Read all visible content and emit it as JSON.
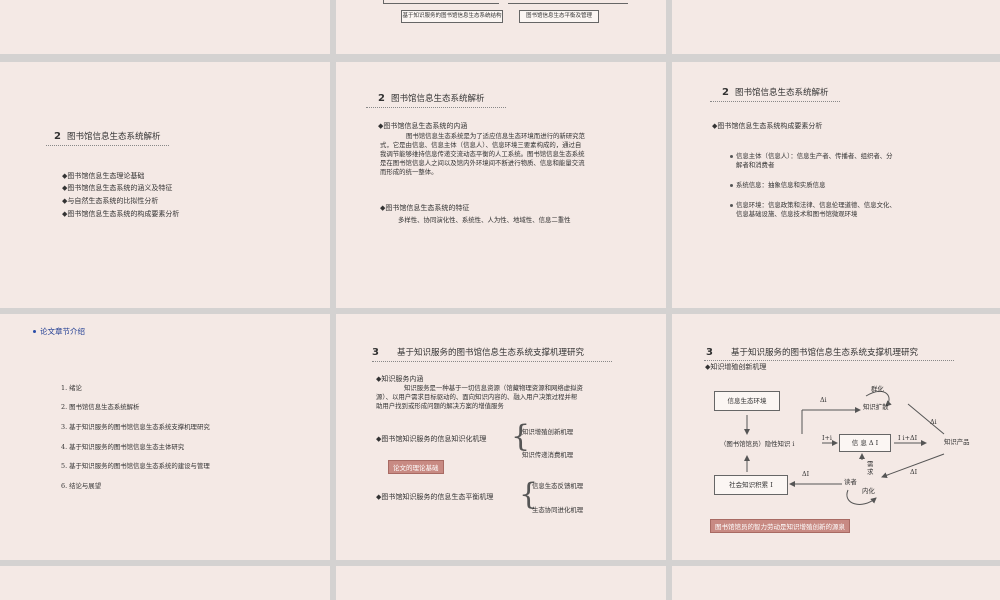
{
  "top_strip": {
    "box_left": "基于知识服务的图书馆信息生态系统结构",
    "box_right": "图书馆信息生态平衡及管理"
  },
  "slide_overview": {
    "number": "2",
    "title": "图书馆信息生态系统解析",
    "items": [
      "◆图书馆信息生态理论基础",
      "◆图书馆信息生态系统的涵义及特征",
      "◆与自然生态系统的比拟性分析",
      "◆图书馆信息生态系统的构成要素分析"
    ]
  },
  "slide_meaning": {
    "number": "2",
    "title": "图书馆信息生态系统解析",
    "heading1": "◆图书馆信息生态系统的内涵",
    "para1": [
      "图书馆信息生态系统是为了适应信息生态环境而进行的新研究范",
      "式，它是由信息、信息主体（信息人）、信息环境三要素构成的，通过自",
      "我调节能够维持信息传递交流动态平衡的人工系统。图书馆信息生态系统",
      "是在图书馆信息人之间以及馆内外环境间不断进行物质、信息和能量交流",
      "而形成的统一整体。"
    ],
    "heading2": "◆图书馆信息生态系统的特征",
    "para2": "多样性、协同演化性、系统性、人为性、地域性、信息二重性"
  },
  "slide_elements": {
    "number": "2",
    "title": "图书馆信息生态系统解析",
    "heading": "◆图书馆信息生态系统构成要素分析",
    "bullets": [
      [
        "信息主体（信息人）：信息生产者、传播者、组织者、分",
        "解者和消费者"
      ],
      [
        "系统信息：抽象信息和实质信息"
      ],
      [
        "信息环境：信息政策和法律、信息伦理道德、信息文化、",
        "信息基础设施、信息技术和图书馆微观环境"
      ]
    ]
  },
  "slide_chapters": {
    "title": "论文章节介绍",
    "items": [
      "1.  绪论",
      "2.  图书馆信息生态系统解析",
      "3.  基于知识服务的图书馆信息生态系统支撑机理研究",
      "4.  基于知识服务的图书馆信息生态主体研究",
      "5.  基于知识服务的图书馆信息生态系统的建设与管理",
      "6.  结论与展望"
    ]
  },
  "slide_mechanism": {
    "number": "3",
    "title": "基于知识服务的图书馆信息生态系统支撑机理研究",
    "heading1": "◆知识服务内涵",
    "para1": [
      "知识服务是一种基于一切信息资源（馆藏物理资源和网络虚拟资",
      "源）、以用户需求目标驱动的、面向知识内容的、融入用户决策过程并帮",
      "助用户找到或形成问题的解决方案的增值服务"
    ],
    "group1_label": "◆图书馆知识服务的信息知识化机理",
    "group1_items": [
      "知识增殖创新机理",
      "知识传递消费机理"
    ],
    "red_label": "论文的理论基础",
    "group2_label": "◆图书馆知识服务的信息生态平衡机理",
    "group2_items": [
      "信息生态反馈机理",
      "生态协同进化机理"
    ]
  },
  "slide_diagram": {
    "number": "3",
    "title": "基于知识服务的图书馆信息生态系统支撑机理研究",
    "heading": "◆知识增殖创新机理",
    "nodes": {
      "env": "信息生态环境",
      "librarian": "（图书馆馆员）隐性知识 i",
      "info": "信 息 Δ I",
      "social": "社会知识积累 I",
      "knowledge_spread": "知识扩散",
      "knowledge_product": "知识产品",
      "reader": "读者",
      "group": "群化",
      "internal": "内化",
      "need": [
        "需",
        "求"
      ]
    },
    "labels": {
      "delta_i_top": "Δi",
      "i_plus_i": "I+i",
      "i_plus_delta": "I i+ΔI",
      "delta_i_right": "Δi",
      "delta_I_left": "ΔI",
      "delta_I_right": "ΔI"
    },
    "red_note": "图书馆馆员的智力劳动是知识增殖创新的源泉"
  }
}
